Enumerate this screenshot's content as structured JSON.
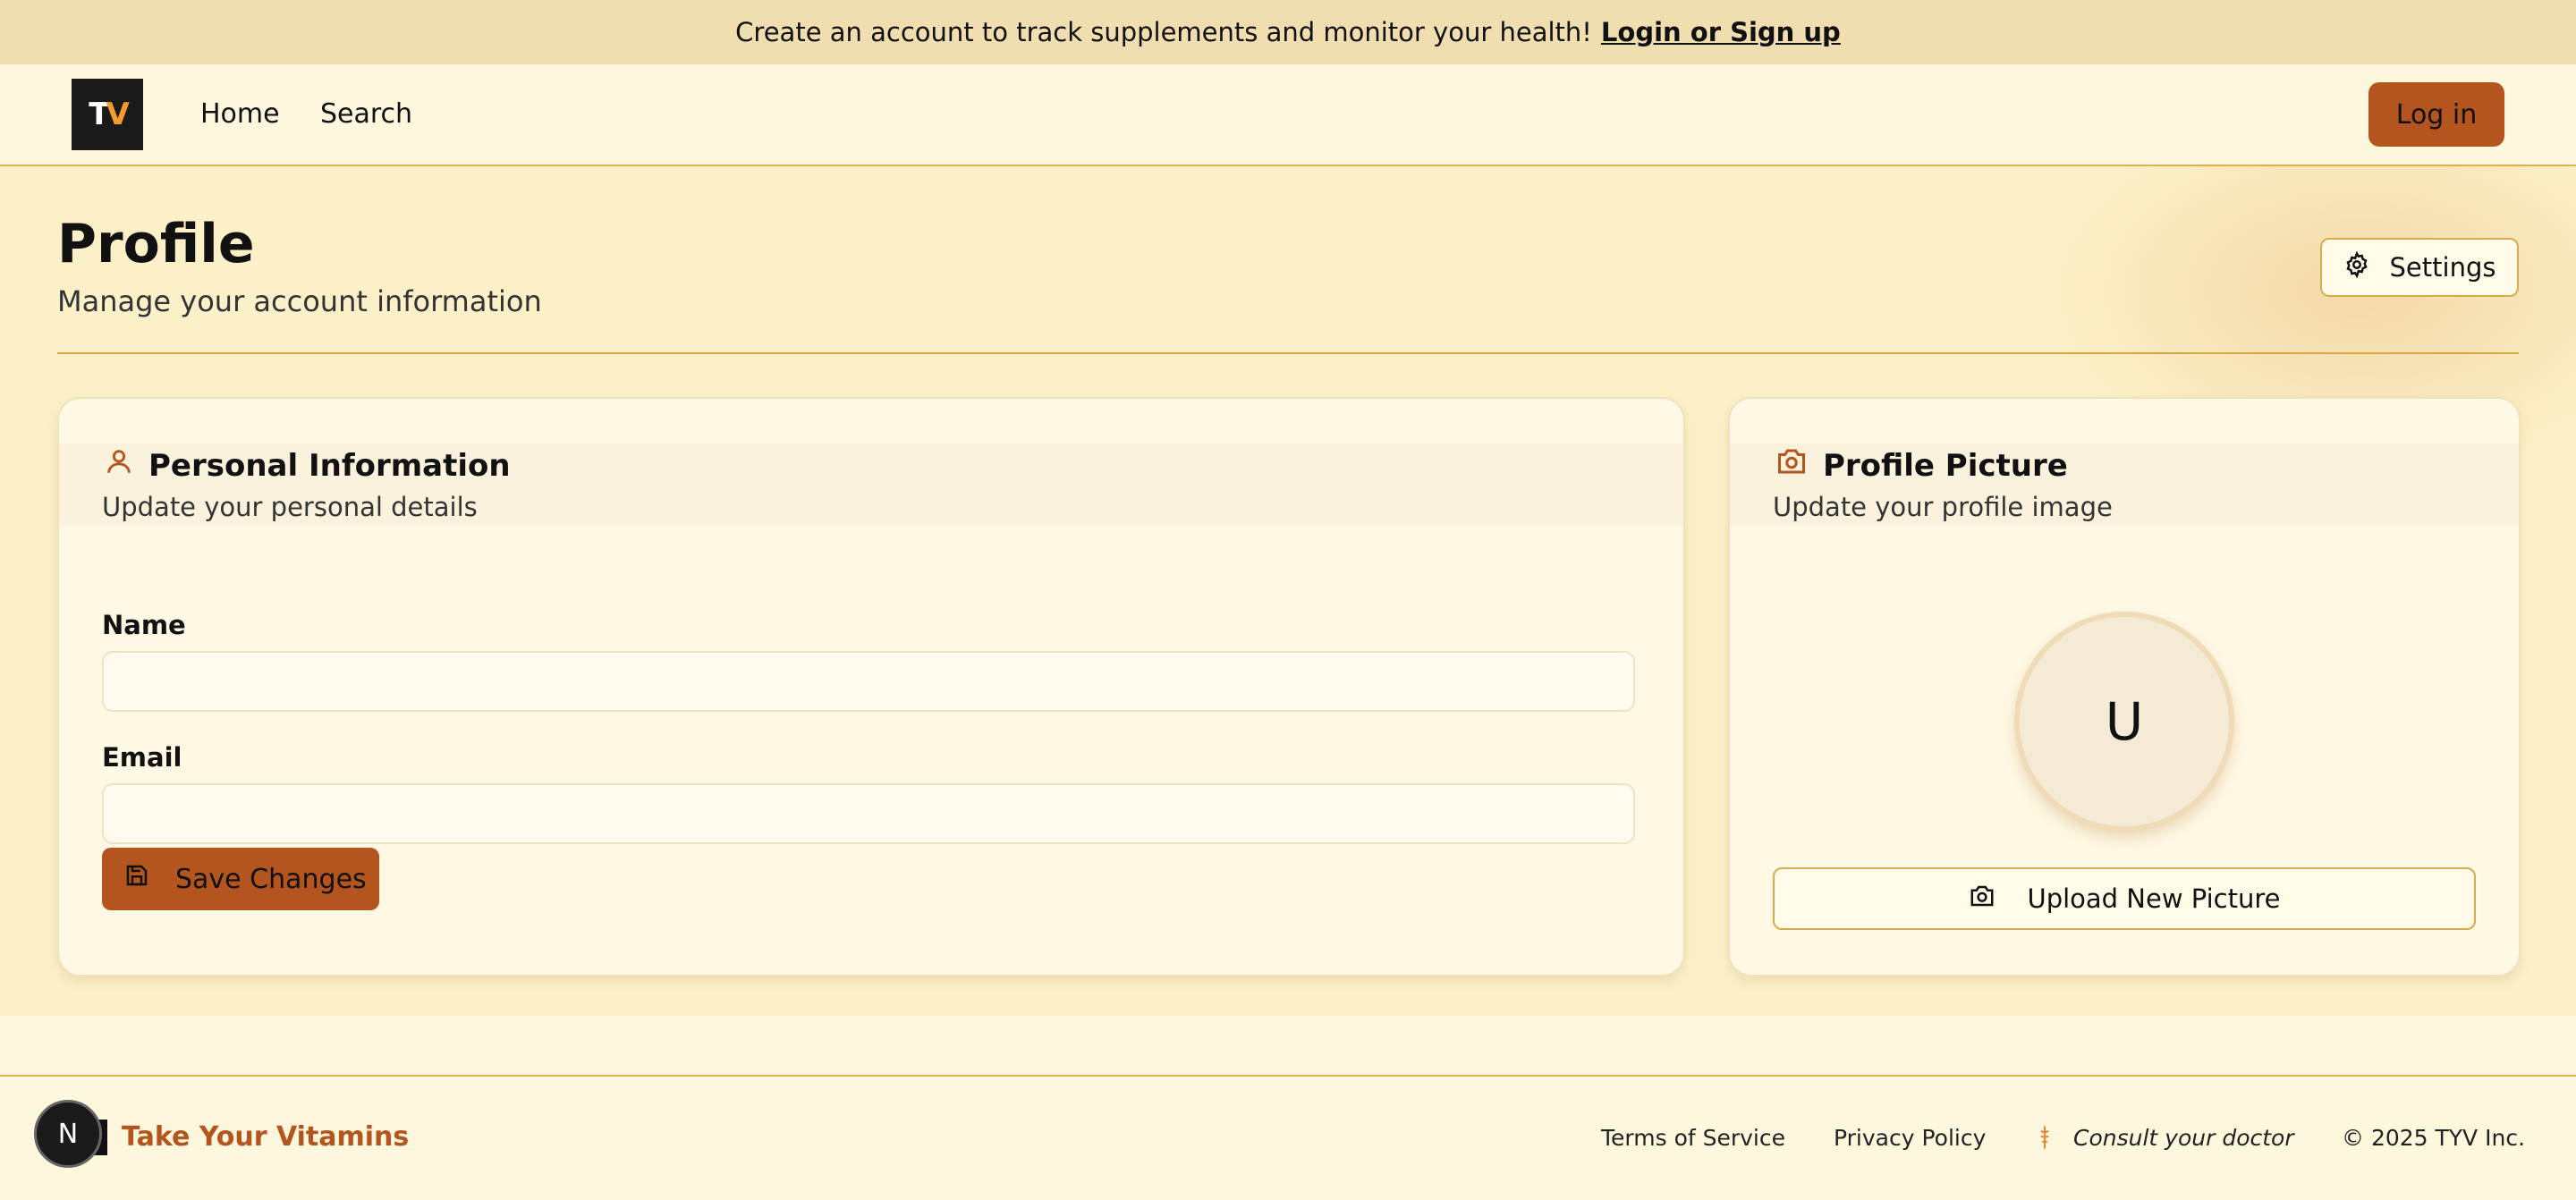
{
  "banner": {
    "text": "Create an account to track supplements and monitor your health!",
    "link": "Login or Sign up"
  },
  "nav": {
    "logo_text": "TYV",
    "home": "Home",
    "search": "Search",
    "login": "Log in"
  },
  "page": {
    "title": "Profile",
    "subtitle": "Manage your account information",
    "settings": "Settings"
  },
  "personal": {
    "title": "Personal Information",
    "description": "Update your personal details",
    "name_label": "Name",
    "name_value": "",
    "email_label": "Email",
    "email_value": "",
    "save": "Save Changes"
  },
  "picture": {
    "title": "Profile Picture",
    "description": "Update your profile image",
    "avatar_initial": "U",
    "upload": "Upload New Picture"
  },
  "footer": {
    "badge": "N",
    "brand": "Take Your Vitamins",
    "terms": "Terms of Service",
    "privacy": "Privacy Policy",
    "consult": "Consult your doctor",
    "copyright": "© 2025 TYV Inc."
  },
  "colors": {
    "accent": "#b4541f",
    "banner_bg": "#f0ddb0",
    "page_bg": "#fcf0c8",
    "border": "#e0b04a"
  },
  "icons": [
    "user-icon",
    "camera-icon",
    "gear-icon",
    "save-icon",
    "caduceus-icon"
  ]
}
